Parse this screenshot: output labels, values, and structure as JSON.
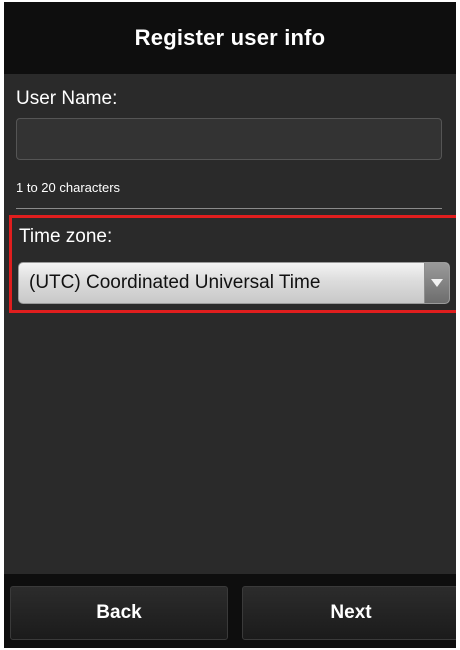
{
  "header": {
    "title": "Register user info"
  },
  "form": {
    "username_label": "User Name:",
    "username_value": "",
    "username_placeholder": "",
    "username_hint": "1 to 20 characters",
    "timezone_label": "Time zone:",
    "timezone_selected": "(UTC) Coordinated Universal Time"
  },
  "footer": {
    "back_label": "Back",
    "next_label": "Next"
  },
  "colors": {
    "highlight_border": "#e01e1e",
    "background": "#2a2a2a",
    "bar_background": "#0e0e0e"
  },
  "icons": {
    "select_arrow": "triangle-down-icon"
  }
}
